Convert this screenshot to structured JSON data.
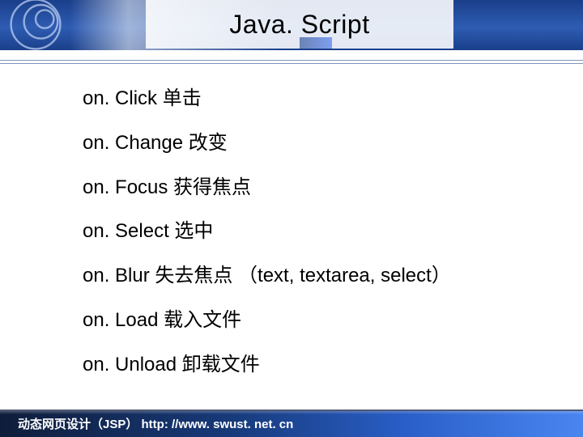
{
  "title": "Java. Script",
  "items": [
    "on. Click  单击",
    "on. Change  改变",
    "on. Focus   获得焦点",
    "on. Select  选中",
    "on. Blur   失去焦点 （text, textarea, select）",
    "on. Load   载入文件",
    "on. Unload  卸载文件"
  ],
  "footer": "动态网页设计（JSP） http: //www. swust. net. cn"
}
